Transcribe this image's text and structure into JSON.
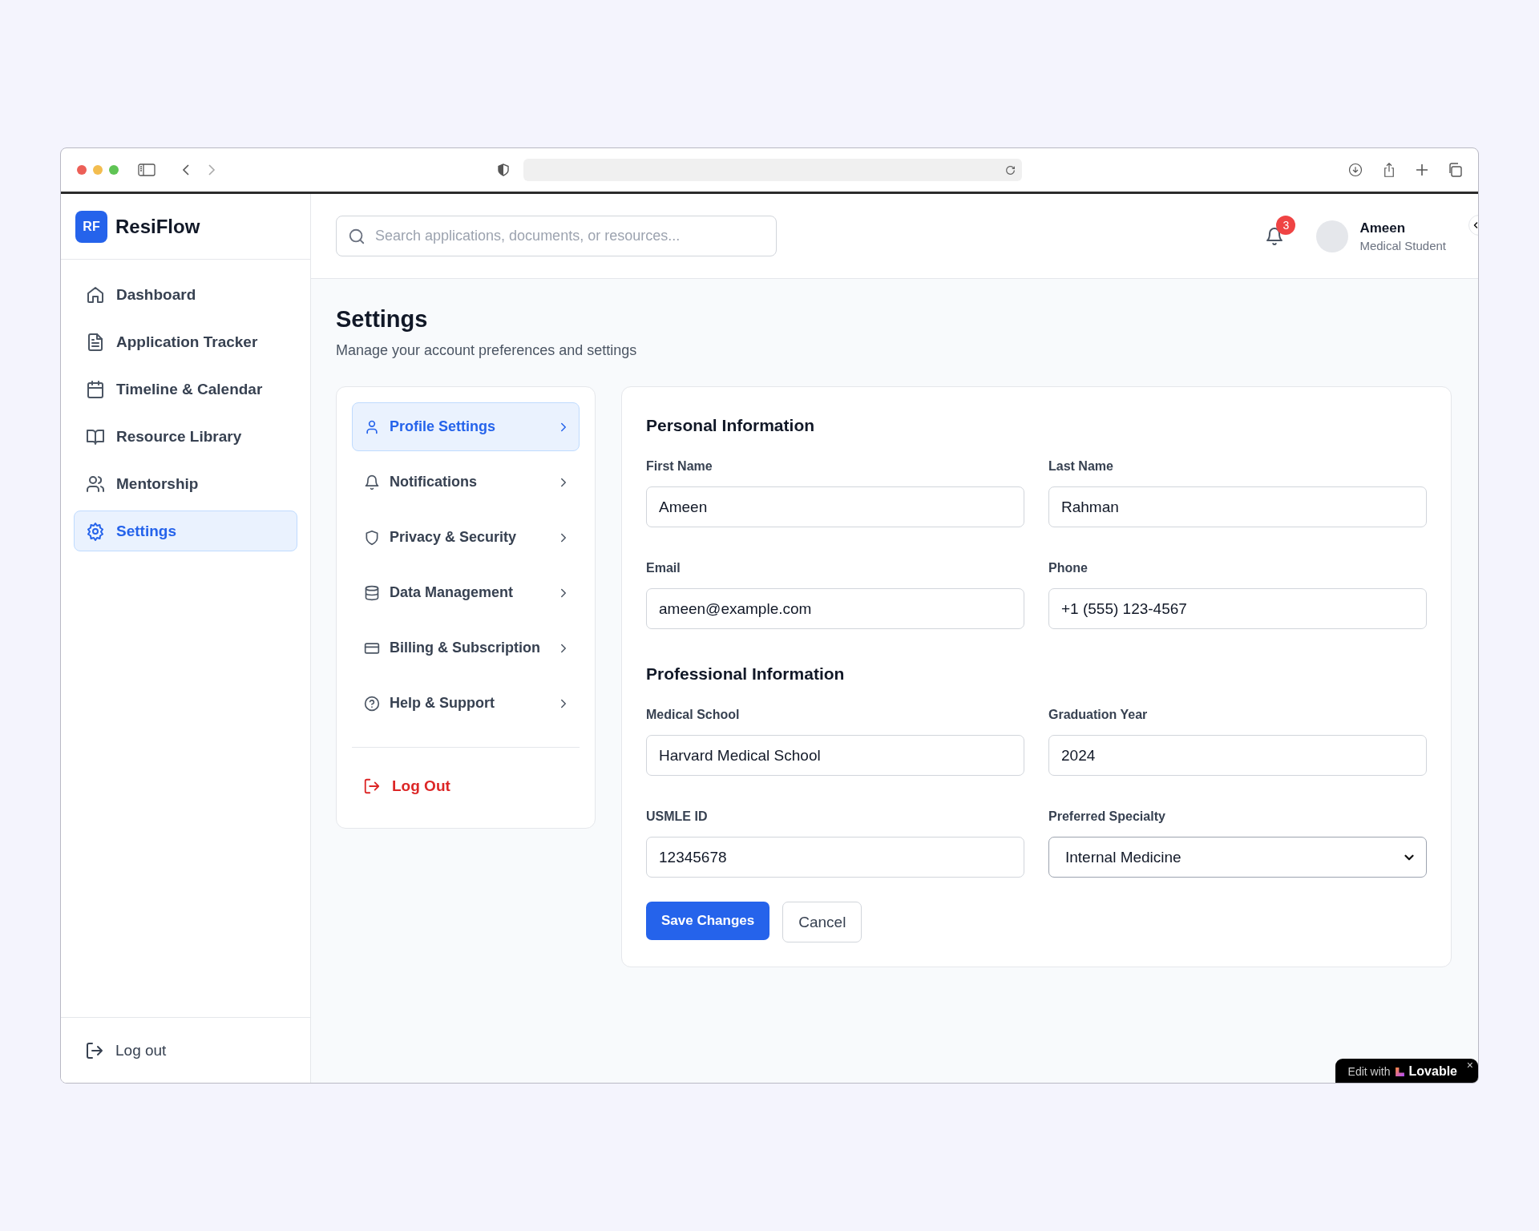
{
  "sidebar": {
    "logo_mark": "RF",
    "logo_name": "ResiFlow",
    "items": [
      {
        "label": "Dashboard",
        "kind": "home",
        "selected": false
      },
      {
        "label": "Application Tracker",
        "kind": "file",
        "selected": false
      },
      {
        "label": "Timeline & Calendar",
        "kind": "calendar",
        "selected": false
      },
      {
        "label": "Resource Library",
        "kind": "book",
        "selected": false
      },
      {
        "label": "Mentorship",
        "kind": "users",
        "selected": false
      },
      {
        "label": "Settings",
        "kind": "gear",
        "selected": true
      }
    ],
    "footer": "Log out"
  },
  "header": {
    "search": {
      "placeholder": "Search applications, documents, or resources..."
    },
    "notification_count": "3",
    "user_name": "Ameen",
    "user_role": "Medical Student"
  },
  "page": {
    "title": "Settings",
    "subtitle": "Manage your account preferences and settings"
  },
  "settings_nav": {
    "items": [
      {
        "label": "Profile Settings",
        "kind": "user",
        "selected": true
      },
      {
        "label": "Notifications",
        "kind": "bell",
        "selected": false
      },
      {
        "label": "Privacy & Security",
        "kind": "shield",
        "selected": false
      },
      {
        "label": "Data Management",
        "kind": "database",
        "selected": false
      },
      {
        "label": "Billing & Subscription",
        "kind": "card",
        "selected": false
      },
      {
        "label": "Help & Support",
        "kind": "help",
        "selected": false
      }
    ],
    "logout": "Log Out"
  },
  "form": {
    "sections": [
      {
        "title": "Personal Information",
        "fields": [
          {
            "label": "First Name",
            "value": "Ameen",
            "kind": "text"
          },
          {
            "label": "Last Name",
            "value": "Rahman",
            "kind": "text"
          },
          {
            "label": "Email",
            "value": "ameen@example.com",
            "kind": "text"
          },
          {
            "label": "Phone",
            "value": "+1 (555) 123-4567",
            "kind": "text"
          }
        ]
      },
      {
        "title": "Professional Information",
        "fields": [
          {
            "label": "Medical School",
            "value": "Harvard Medical School",
            "kind": "text"
          },
          {
            "label": "Graduation Year",
            "value": "2024",
            "kind": "text"
          },
          {
            "label": "USMLE ID",
            "value": "12345678",
            "kind": "text"
          },
          {
            "label": "Preferred Specialty",
            "value": "Internal Medicine",
            "kind": "select"
          }
        ]
      }
    ],
    "buttons": [
      {
        "label": "Save Changes",
        "kind": "primary"
      },
      {
        "label": "Cancel",
        "kind": "secondary"
      }
    ]
  },
  "badge": {
    "text": "Edit with",
    "brand": "Lovable",
    "close": "×"
  }
}
